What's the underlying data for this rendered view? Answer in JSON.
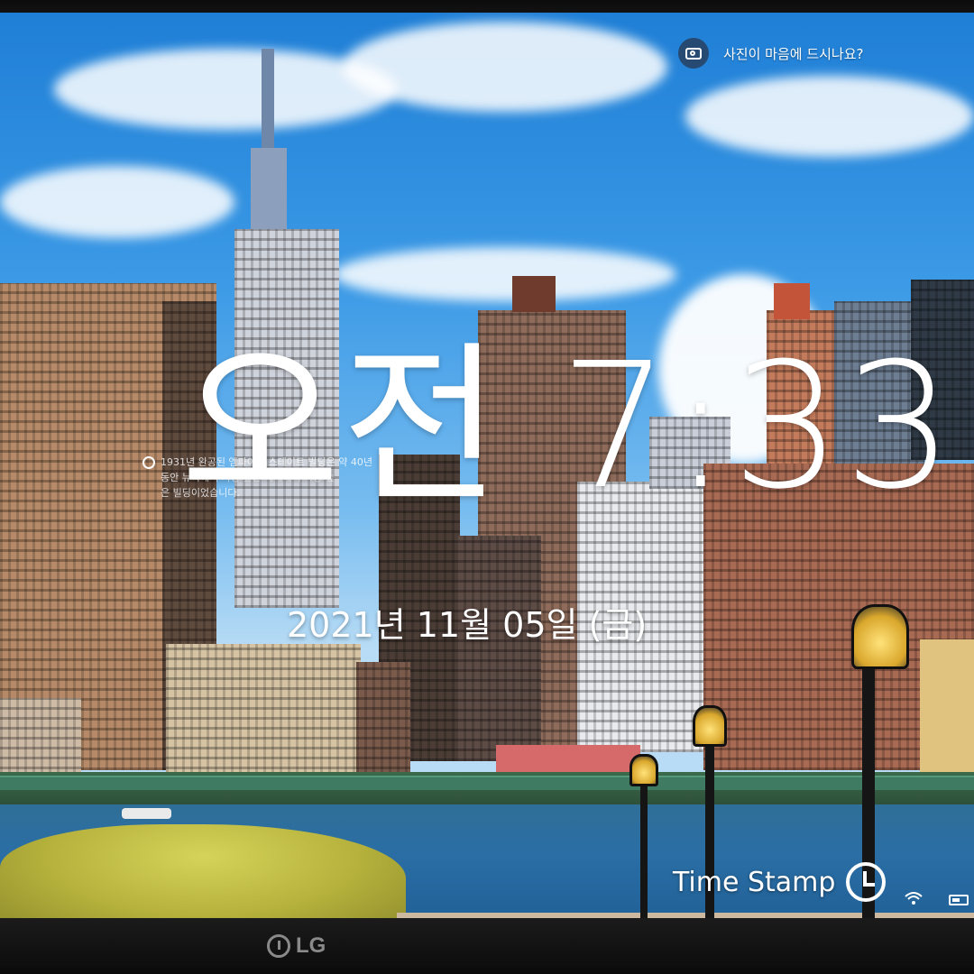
{
  "lock_screen": {
    "photo_prompt": "사진이 마음에 드시나요?",
    "time": "오전 7:33",
    "date": "2021년 11월 05일 (금)",
    "info_text_line1": "1931년 완공된 엠파이어 스테이트 빌딩은 약 40년",
    "info_text_line2": "동안 뉴욕에서 가장 높은 세계에서 가장 높",
    "info_text_line3": "은 빌딩이었습니다."
  },
  "watermark": {
    "text": "Time Stamp"
  },
  "monitor": {
    "brand": "LG"
  },
  "icons": {
    "photo_feedback": "camera-icon",
    "info": "info-icon",
    "watermark": "clock-icon",
    "network": "wifi-icon",
    "power": "battery-icon"
  },
  "colors": {
    "sky": "#3c9ae6",
    "clock_text": "#ffffff",
    "water": "#2a6ea5"
  }
}
